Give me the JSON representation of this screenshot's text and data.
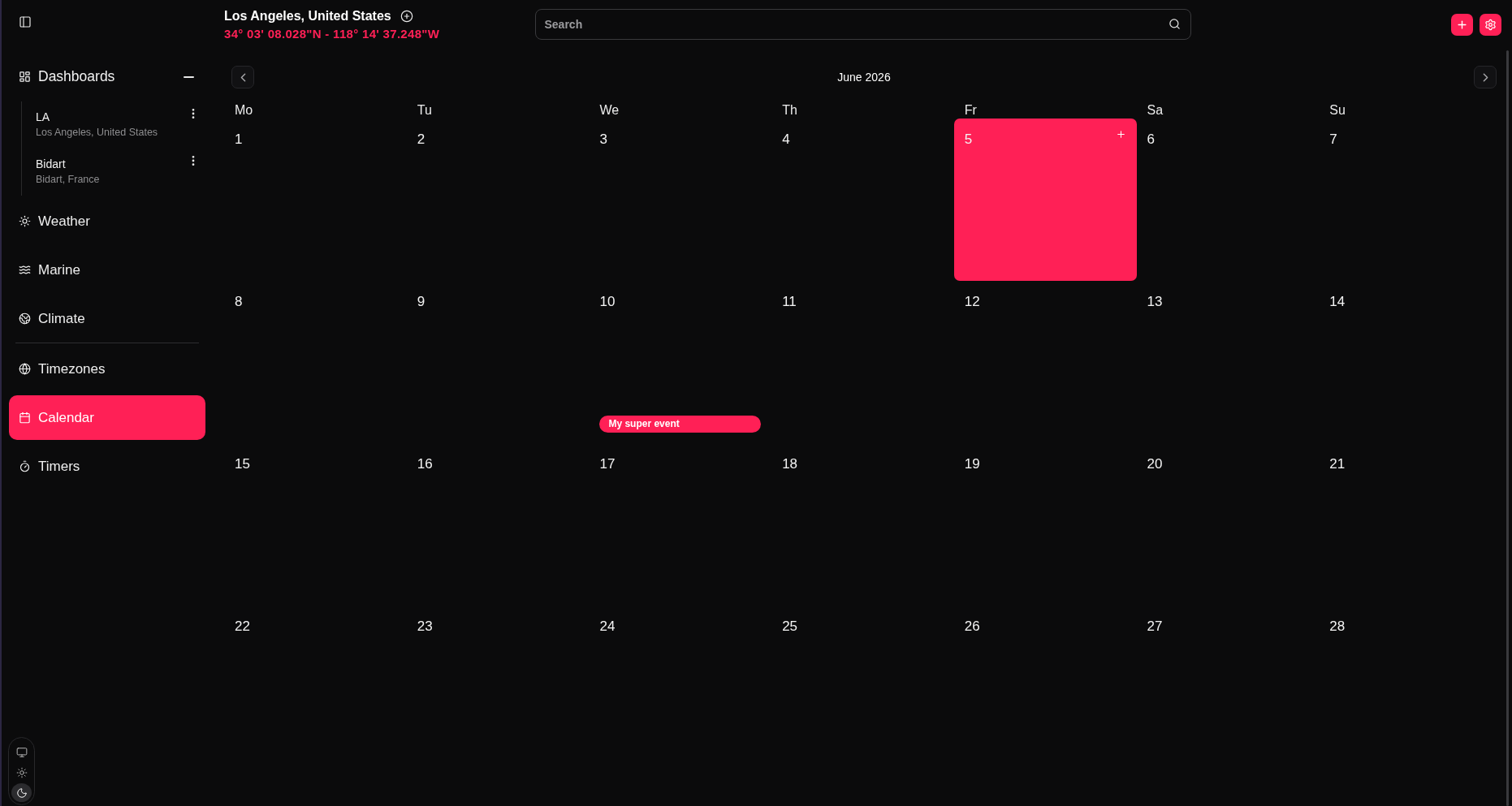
{
  "sidebar": {
    "dashboards": {
      "label": "Dashboards",
      "expanded": true,
      "items": [
        {
          "name": "LA",
          "location": "Los Angeles, United States"
        },
        {
          "name": "Bidart",
          "location": "Bidart, France"
        }
      ]
    },
    "sections": [
      {
        "items": [
          {
            "label": "Weather",
            "selected": false
          },
          {
            "label": "Marine",
            "selected": false
          },
          {
            "label": "Climate",
            "selected": false
          }
        ]
      },
      {
        "items": [
          {
            "label": "Timezones",
            "selected": false
          },
          {
            "label": "Calendar",
            "selected": true
          },
          {
            "label": "Timers",
            "selected": false
          }
        ]
      }
    ],
    "theme_options": [
      {
        "kind": "system",
        "selected": false
      },
      {
        "kind": "light",
        "selected": false
      },
      {
        "kind": "dark",
        "selected": true
      }
    ]
  },
  "header": {
    "location": "Los Angeles, United States",
    "coordinates": "34° 03' 08.028\"N - 118° 14' 37.248\"W",
    "search": {
      "placeholder": "Search"
    }
  },
  "calendar": {
    "month": "June 2026",
    "weekdays": [
      "Mo",
      "Tu",
      "We",
      "Th",
      "Fr",
      "Sa",
      "Su"
    ],
    "weeks": [
      {
        "days": [
          {
            "label": "1",
            "selected": false
          },
          {
            "label": "2",
            "selected": false
          },
          {
            "label": "3",
            "selected": false
          },
          {
            "label": "4",
            "selected": false
          },
          {
            "label": "5",
            "selected": true
          },
          {
            "label": "6",
            "selected": false
          },
          {
            "label": "7",
            "selected": false
          }
        ]
      },
      {
        "days": [
          {
            "label": "8",
            "selected": false
          },
          {
            "label": "9",
            "selected": false
          },
          {
            "label": "10",
            "selected": false,
            "events": [
              {
                "title": "My super event"
              }
            ]
          },
          {
            "label": "11",
            "selected": false
          },
          {
            "label": "12",
            "selected": false
          },
          {
            "label": "13",
            "selected": false
          },
          {
            "label": "14",
            "selected": false
          }
        ]
      },
      {
        "days": [
          {
            "label": "15",
            "selected": false
          },
          {
            "label": "16",
            "selected": false
          },
          {
            "label": "17",
            "selected": false
          },
          {
            "label": "18",
            "selected": false
          },
          {
            "label": "19",
            "selected": false
          },
          {
            "label": "20",
            "selected": false
          },
          {
            "label": "21",
            "selected": false
          }
        ]
      },
      {
        "days": [
          {
            "label": "22",
            "selected": false
          },
          {
            "label": "23",
            "selected": false
          },
          {
            "label": "24",
            "selected": false
          },
          {
            "label": "25",
            "selected": false
          },
          {
            "label": "26",
            "selected": false
          },
          {
            "label": "27",
            "selected": false
          },
          {
            "label": "28",
            "selected": false
          }
        ]
      }
    ]
  }
}
